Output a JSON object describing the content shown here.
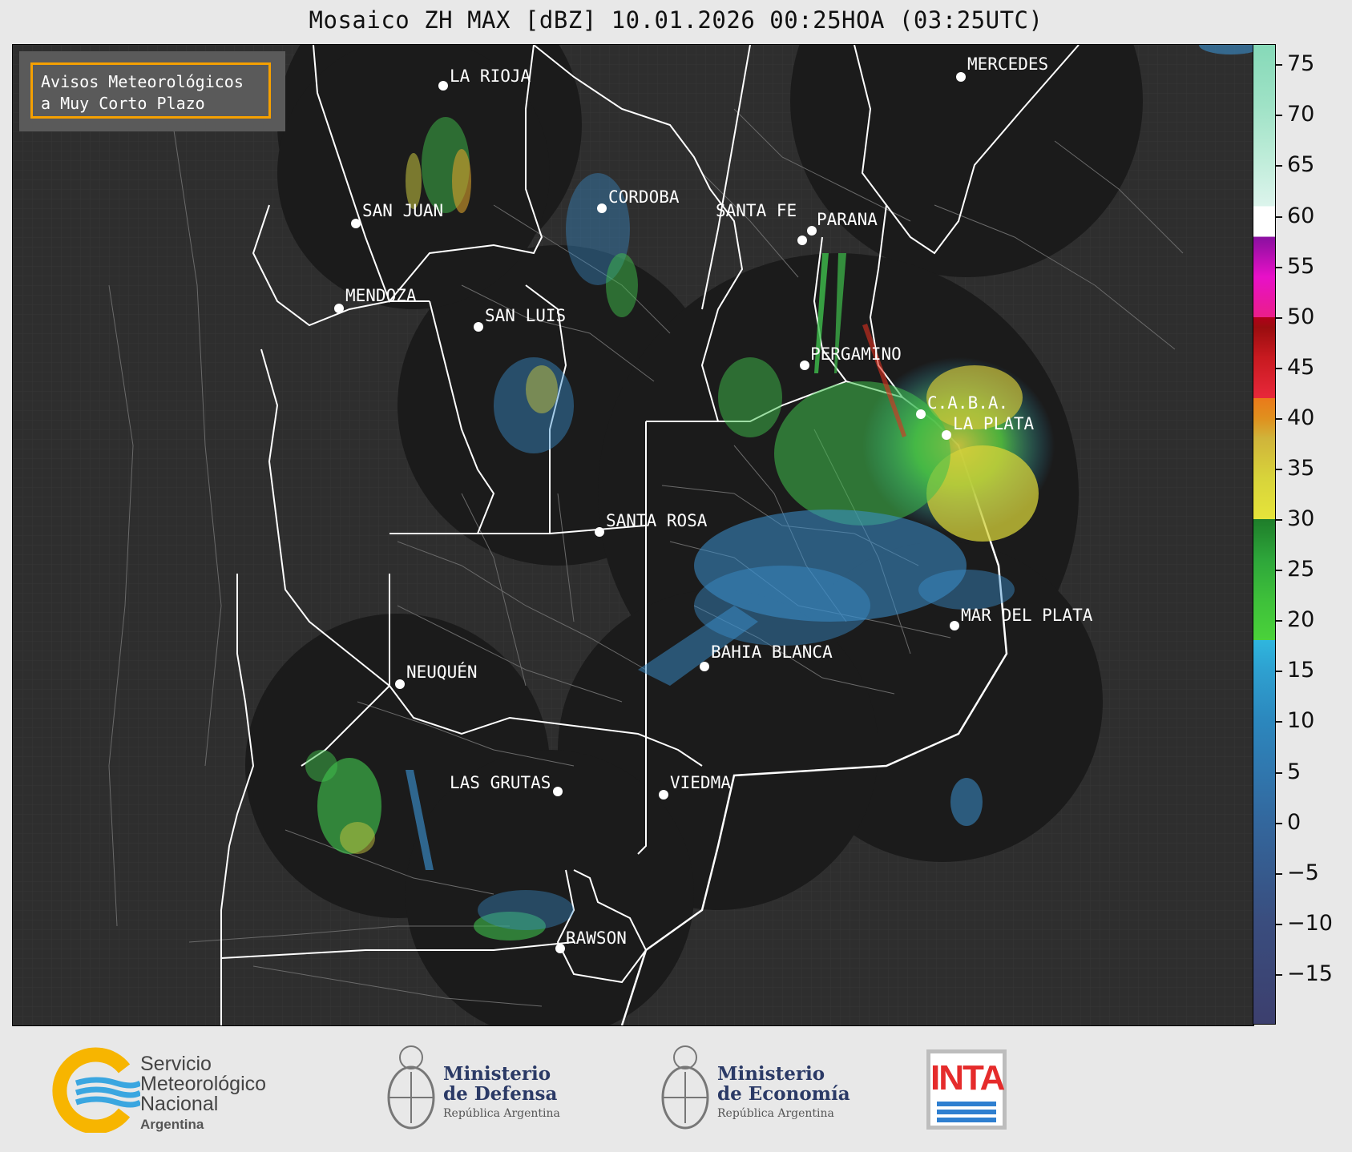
{
  "title": "Mosaico ZH MAX [dBZ] 10.01.2026 00:25HOA (03:25UTC)",
  "notice": {
    "line1": "Avisos Meteorológicos",
    "line2": "a Muy Corto Plazo"
  },
  "cities": [
    {
      "name": "LA RIOJA"
    },
    {
      "name": "MERCEDES"
    },
    {
      "name": "CORDOBA"
    },
    {
      "name": "SAN JUAN"
    },
    {
      "name": "SANTA FE"
    },
    {
      "name": "PARANA"
    },
    {
      "name": "MENDOZA"
    },
    {
      "name": "SAN LUIS"
    },
    {
      "name": "PERGAMINO"
    },
    {
      "name": "C.A.B.A."
    },
    {
      "name": "LA PLATA"
    },
    {
      "name": "SANTA ROSA"
    },
    {
      "name": "MAR DEL PLATA"
    },
    {
      "name": "BAHIA BLANCA"
    },
    {
      "name": "NEUQUÉN"
    },
    {
      "name": "LAS GRUTAS"
    },
    {
      "name": "VIEDMA"
    },
    {
      "name": "RAWSON"
    }
  ],
  "colorbar": {
    "unit": "dBZ",
    "min": -20,
    "max": 77,
    "ticks": [
      "75",
      "70",
      "65",
      "60",
      "55",
      "50",
      "45",
      "40",
      "35",
      "30",
      "25",
      "20",
      "15",
      "10",
      "5",
      "0",
      "−5",
      "−10",
      "−15"
    ]
  },
  "footer": {
    "smn": {
      "line1": "Servicio",
      "line2": "Meteorológico",
      "line3": "Nacional",
      "line4": "Argentina"
    },
    "defensa": {
      "line1": "Ministerio",
      "line2": "de Defensa",
      "line3": "República Argentina"
    },
    "economia": {
      "line1": "Ministerio",
      "line2": "de Economía",
      "line3": "República Argentina"
    },
    "inta": {
      "word": "INTA"
    }
  },
  "colors": {
    "map_background": "#2e2e2e",
    "radar_coverage": "#1b1b1b",
    "notice_border": "#f5a000",
    "smn_yellow": "#f7b500",
    "smn_blue": "#3aa6e0",
    "ministry_blue": "#2b3a66",
    "inta_red": "#e52b2b"
  }
}
